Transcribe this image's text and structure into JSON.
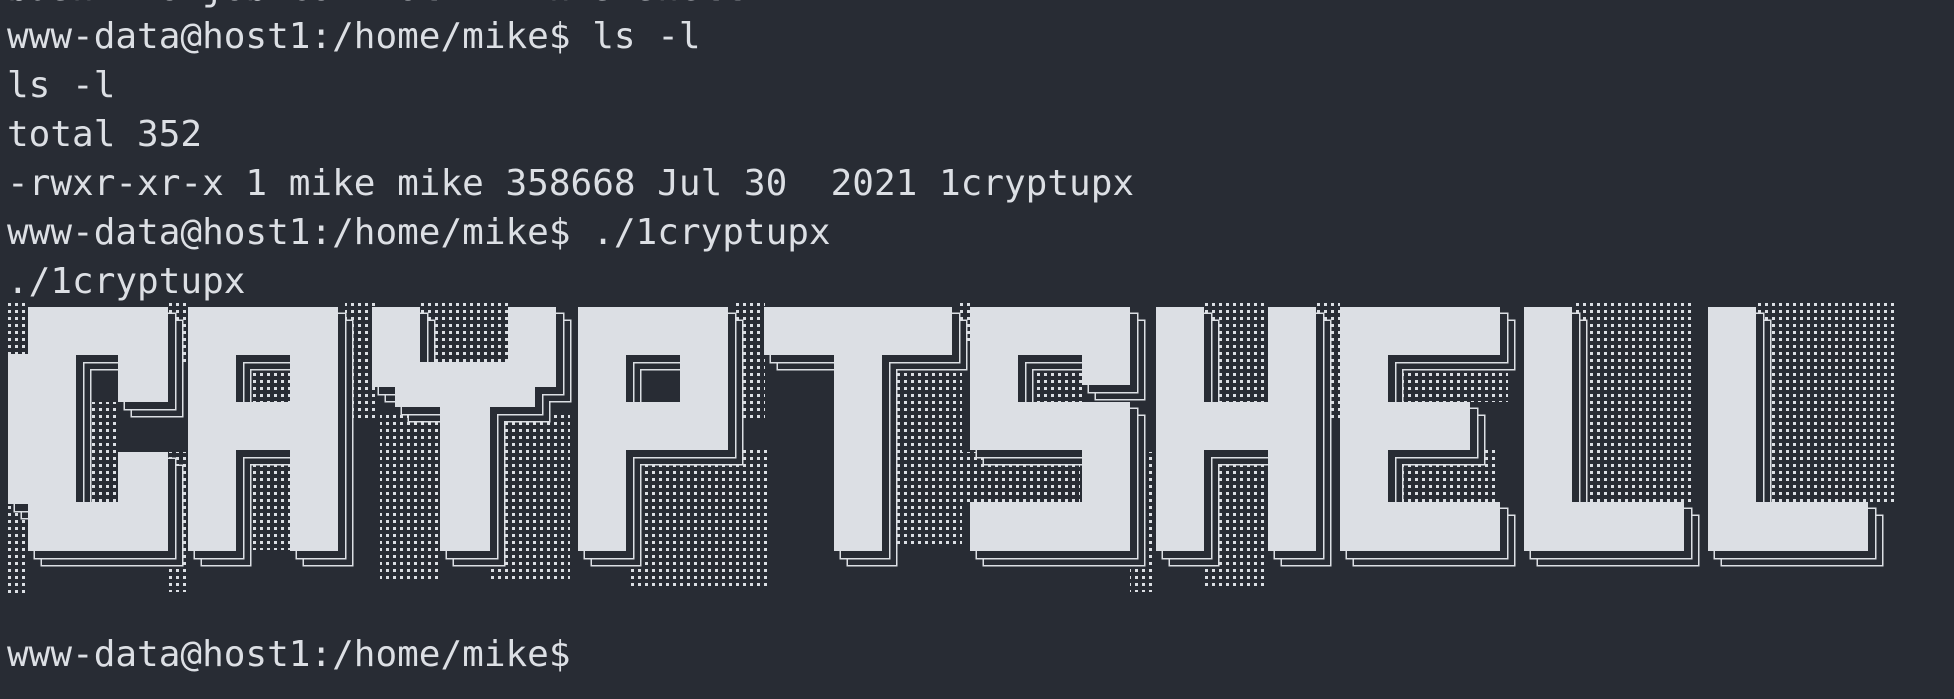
{
  "terminal": {
    "previous_output_fragment": "bash: no job control in this shell",
    "lines": [
      "www-data@host1:/home/mike$ ls -l",
      "ls -l",
      "total 352",
      "-rwxr-xr-x 1 mike mike 358668 Jul 30  2021 1cryptupx",
      "www-data@host1:/home/mike$ ./1cryptupx",
      "./1cryptupx"
    ],
    "banner_text": "CRYPTSHELL",
    "final_prompt": "www-data@host1:/home/mike$"
  },
  "colors": {
    "background": "#282c34",
    "foreground": "#dcdfe4"
  }
}
